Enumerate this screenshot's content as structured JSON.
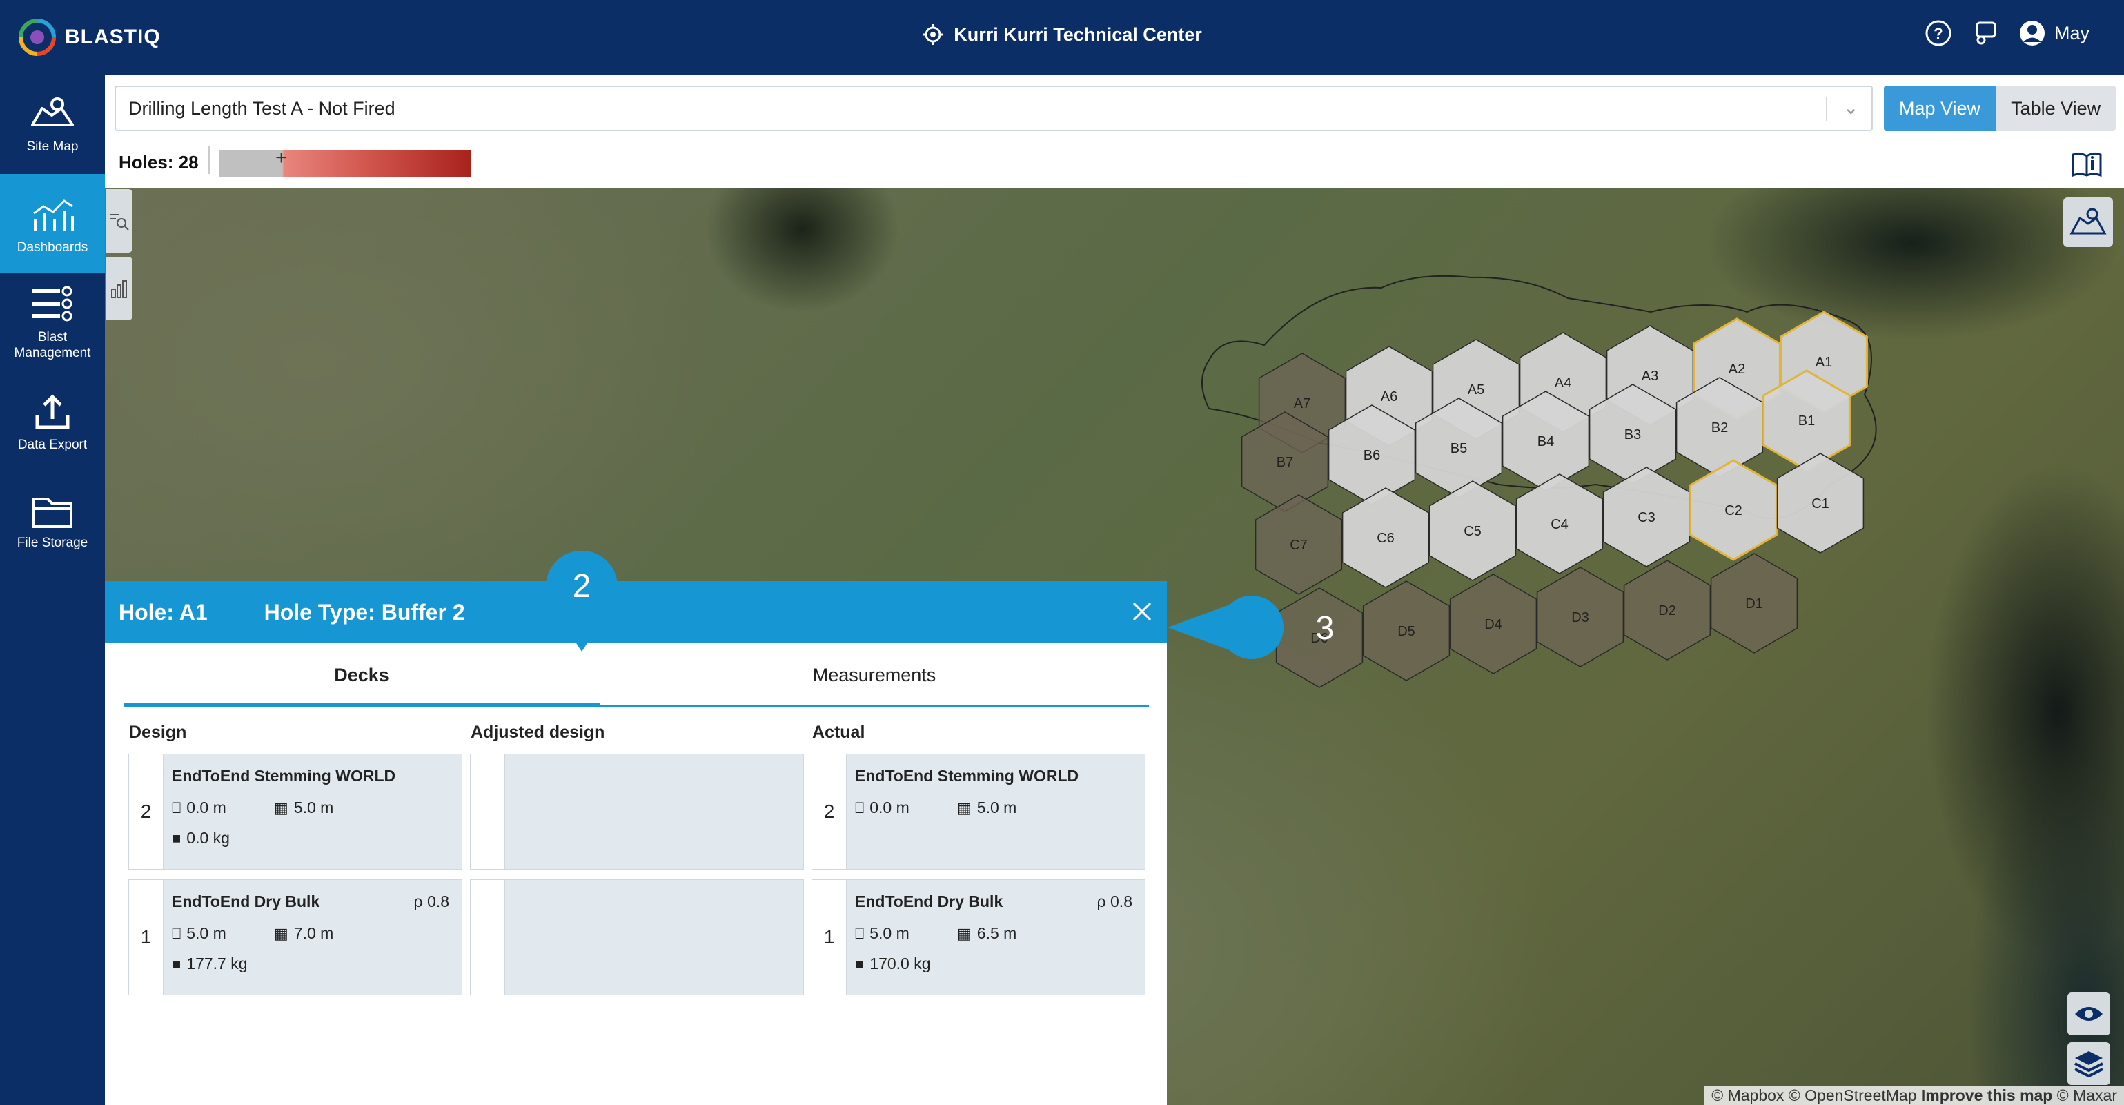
{
  "app": {
    "name": "BLASTIQ"
  },
  "header": {
    "site_name": "Kurri Kurri Technical Center",
    "user_name": "May"
  },
  "sidebar": {
    "items": [
      {
        "label": "Site Map",
        "icon": "map-icon"
      },
      {
        "label": "Dashboards",
        "icon": "dashboard-icon",
        "active": true
      },
      {
        "label": "Blast Management",
        "icon": "list-icon"
      },
      {
        "label": "Data Export",
        "icon": "upload-icon"
      },
      {
        "label": "File Storage",
        "icon": "folder-icon"
      }
    ]
  },
  "blast_select": {
    "value": "Drilling Length Test A - Not Fired"
  },
  "views": {
    "map_view": "Map View",
    "table_view": "Table View",
    "active": "Map View"
  },
  "holes": {
    "label": "Holes: 28"
  },
  "color_ramp": {
    "colors": [
      "#c0c0c0",
      "#e8857d",
      "#a8221c"
    ],
    "marker": "+"
  },
  "map": {
    "attribution": {
      "mapbox": "© Mapbox",
      "osm": "© OpenStreetMap",
      "improve": "Improve this map",
      "maxar": "© Maxar"
    },
    "holes": [
      {
        "id": "A7",
        "status": "dark"
      },
      {
        "id": "A6",
        "status": "light"
      },
      {
        "id": "A5",
        "status": "light"
      },
      {
        "id": "A4",
        "status": "light"
      },
      {
        "id": "A3",
        "status": "light"
      },
      {
        "id": "A2",
        "status": "light",
        "selected": true
      },
      {
        "id": "A1",
        "status": "light",
        "selected": true
      },
      {
        "id": "B7",
        "status": "dark"
      },
      {
        "id": "B6",
        "status": "light"
      },
      {
        "id": "B5",
        "status": "light"
      },
      {
        "id": "B4",
        "status": "light"
      },
      {
        "id": "B3",
        "status": "light"
      },
      {
        "id": "B2",
        "status": "light"
      },
      {
        "id": "B1",
        "status": "light",
        "selected": true
      },
      {
        "id": "C7",
        "status": "dark"
      },
      {
        "id": "C6",
        "status": "light"
      },
      {
        "id": "C5",
        "status": "light"
      },
      {
        "id": "C4",
        "status": "light"
      },
      {
        "id": "C3",
        "status": "light"
      },
      {
        "id": "C2",
        "status": "light",
        "selected": true
      },
      {
        "id": "C1",
        "status": "light"
      },
      {
        "id": "D6",
        "status": "dark"
      },
      {
        "id": "D5",
        "status": "dark"
      },
      {
        "id": "D4",
        "status": "dark"
      },
      {
        "id": "D3",
        "status": "dark"
      },
      {
        "id": "D2",
        "status": "dark"
      },
      {
        "id": "D1",
        "status": "dark"
      }
    ],
    "colors": {
      "light": "#d4d4d4",
      "dark": "#6e6656",
      "selected_border": "#e2b43a"
    }
  },
  "panel": {
    "hole_label": "Hole: A1",
    "hole_type_label": "Hole Type: Buffer 2",
    "tabs": [
      {
        "label": "Decks",
        "active": true
      },
      {
        "label": "Measurements",
        "active": false
      }
    ],
    "columns": {
      "design": "Design",
      "adjusted": "Adjusted design",
      "actual": "Actual"
    },
    "design": [
      {
        "num": "2",
        "name": "EndToEnd Stemming WORLD",
        "rho": "",
        "depth": "0.0 m",
        "length": "5.0 m",
        "mass": "0.0 kg"
      },
      {
        "num": "1",
        "name": "EndToEnd Dry Bulk",
        "rho": "ρ 0.8",
        "depth": "5.0 m",
        "length": "7.0 m",
        "mass": "177.7 kg"
      }
    ],
    "actual": [
      {
        "num": "2",
        "name": "EndToEnd Stemming WORLD",
        "rho": "",
        "depth": "0.0 m",
        "length": "5.0 m",
        "mass": ""
      },
      {
        "num": "1",
        "name": "EndToEnd Dry Bulk",
        "rho": "ρ 0.8",
        "depth": "5.0 m",
        "length": "6.5 m",
        "mass": "170.0 kg"
      }
    ]
  },
  "callouts": [
    {
      "number": "2"
    },
    {
      "number": "3"
    }
  ],
  "accent_colors": {
    "primary": "#1796d4",
    "navy": "#0b2e66"
  }
}
